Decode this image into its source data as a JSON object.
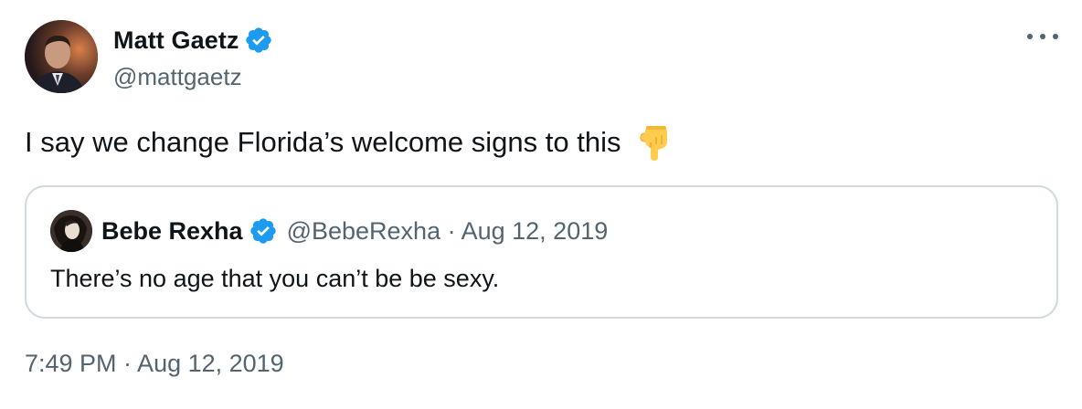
{
  "tweet": {
    "author": {
      "name": "Matt Gaetz",
      "handle": "@mattgaetz",
      "verified": true
    },
    "text": "I say we change Florida’s welcome signs to this",
    "emoji_icon": "backhand-index-pointing-down-icon",
    "more_icon": "more-options-icon",
    "timestamp": "7:49 PM · Aug 12, 2019"
  },
  "quoted_tweet": {
    "author": {
      "name": "Bebe Rexha",
      "handle": "@BebeRexha",
      "verified": true
    },
    "meta": "@BebeRexha · Aug 12, 2019",
    "text": "There’s no age that you can’t be be sexy."
  },
  "colors": {
    "verified_badge": "#1d9bf0",
    "secondary_text": "#536471",
    "primary_text": "#0f1419",
    "border": "#cfd9de",
    "emoji": "#ffcc4d"
  }
}
